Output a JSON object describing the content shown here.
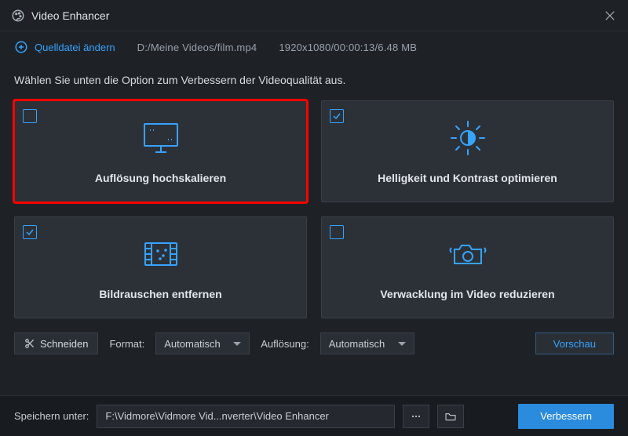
{
  "window": {
    "title": "Video Enhancer"
  },
  "source": {
    "change_label": "Quelldatei ändern",
    "path": "D:/Meine Videos/film.mp4",
    "info": "1920x1080/00:00:13/6.48 MB"
  },
  "intro": "Wählen Sie unten die Option zum Verbessern der Videoqualität aus.",
  "cards": [
    {
      "label": "Auflösung hochskalieren",
      "checked": false,
      "icon": "monitor"
    },
    {
      "label": "Helligkeit und Kontrast optimieren",
      "checked": true,
      "icon": "sun"
    },
    {
      "label": "Bildrauschen entfernen",
      "checked": true,
      "icon": "film"
    },
    {
      "label": "Verwacklung im Video reduzieren",
      "checked": false,
      "icon": "camera"
    }
  ],
  "options": {
    "cut_label": "Schneiden",
    "format_label": "Format:",
    "format_value": "Automatisch",
    "res_label": "Auflösung:",
    "res_value": "Automatisch",
    "preview_label": "Vorschau"
  },
  "save": {
    "label": "Speichern unter:",
    "path": "F:\\Vidmore\\Vidmore Vid...nverter\\Video Enhancer",
    "enhance_label": "Verbessern"
  }
}
